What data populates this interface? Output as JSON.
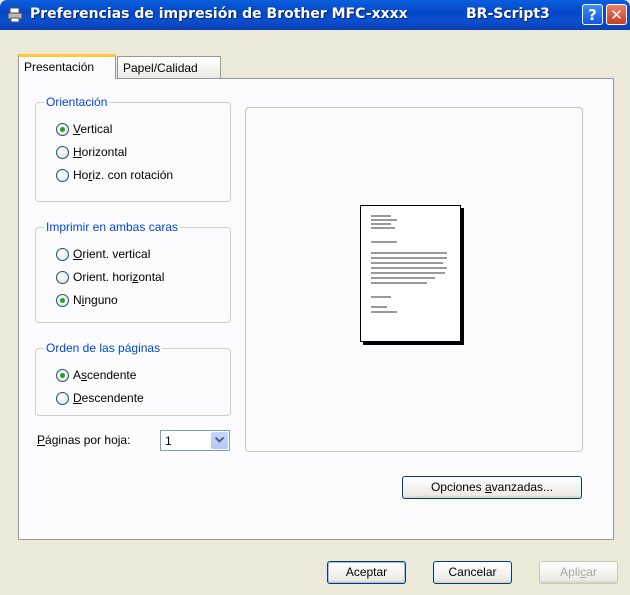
{
  "window": {
    "title": "Preferencias de impresión de Brother MFC-xxxx",
    "title_driver": "BR-Script3",
    "help_label": "?",
    "close_label": "✕"
  },
  "tabs": [
    {
      "label": "Presentación",
      "active": true
    },
    {
      "label": "Papel/Calidad",
      "active": false
    }
  ],
  "orientation": {
    "title": "Orientación",
    "options": [
      {
        "pre": "",
        "key": "V",
        "post": "ertical",
        "checked": true
      },
      {
        "pre": "",
        "key": "H",
        "post": "orizontal",
        "checked": false
      },
      {
        "pre": "Ho",
        "key": "r",
        "post": "iz. con rotación",
        "checked": false
      }
    ]
  },
  "duplex": {
    "title": "Imprimir en ambas caras",
    "options": [
      {
        "pre": "",
        "key": "O",
        "post": "rient. vertical",
        "checked": false
      },
      {
        "pre": "Orient. hori",
        "key": "z",
        "post": "ontal",
        "checked": false
      },
      {
        "pre": "N",
        "key": "i",
        "post": "nguno",
        "checked": true
      }
    ]
  },
  "page_order": {
    "title": "Orden de las páginas",
    "options": [
      {
        "pre": "A",
        "key": "s",
        "post": "cendente",
        "checked": true
      },
      {
        "pre": "",
        "key": "D",
        "post": "escendente",
        "checked": false
      }
    ]
  },
  "pages_per_sheet": {
    "label_key": "P",
    "label_rest": "áginas por hoja:",
    "value": "1"
  },
  "buttons": {
    "advanced_pre": "Opciones ",
    "advanced_key": "a",
    "advanced_post": "vanzadas...",
    "ok": "Aceptar",
    "cancel": "Cancelar",
    "apply_pre": "Apli",
    "apply_key": "c",
    "apply_post": "ar"
  },
  "colors": {
    "group_title": "#0046D5",
    "radio_dot": "#21A121",
    "titlebar": "#0548C8",
    "tab_highlight": "#FFC83C"
  }
}
